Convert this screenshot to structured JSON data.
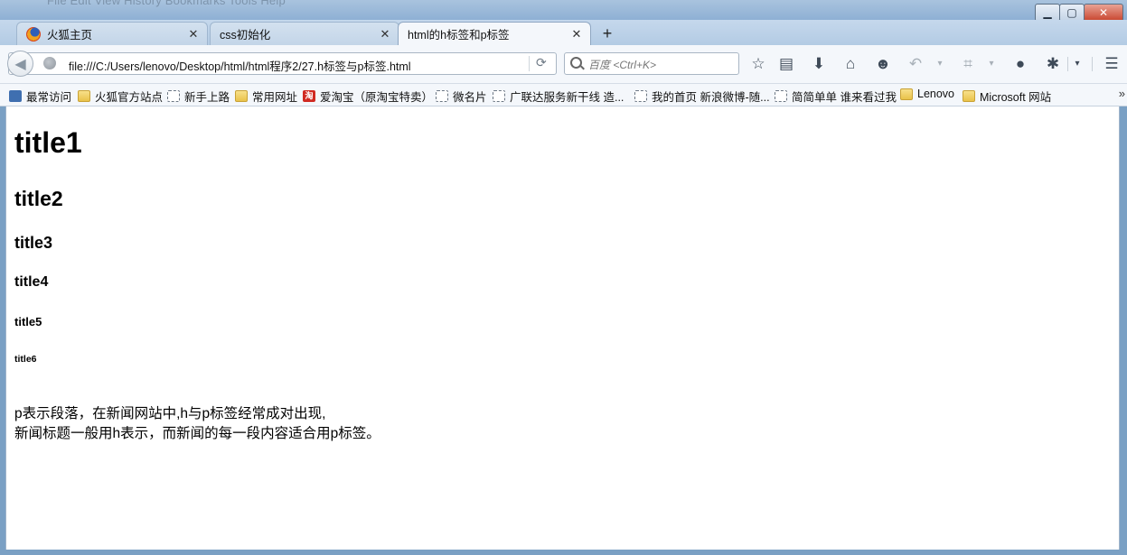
{
  "window": {
    "menubar_ghost": "File  Edit  View  History  Bookmarks  Tools  Help",
    "controls": {
      "minimize": "▁",
      "maximize": "▢",
      "close": "✕"
    }
  },
  "tabs": [
    {
      "label": "火狐主页",
      "close": "✕"
    },
    {
      "label": "css初始化",
      "close": "✕"
    },
    {
      "label": "html的h标签和p标签",
      "close": "✕"
    }
  ],
  "new_tab_label": "+",
  "navbar": {
    "back": "◀",
    "url": "file:///C:/Users/lenovo/Desktop/html/html程序2/27.h标签与p标签.html",
    "reload": "⟳",
    "search_placeholder": "百度 <Ctrl+K>",
    "tools": {
      "bookmark_star": "☆",
      "reading_list": "▤",
      "download": "⬇",
      "home": "⌂",
      "chat": "☻",
      "undo": "↶",
      "dropdown": "▾",
      "crop": "⌗",
      "comment": "●",
      "bug": "✱",
      "menu": "☰"
    }
  },
  "bookmarks": [
    {
      "label": "最常访问",
      "icon": "blue-icon"
    },
    {
      "label": "火狐官方站点",
      "icon": "folder-icon"
    },
    {
      "label": "新手上路",
      "icon": "page-icon"
    },
    {
      "label": "常用网址",
      "icon": "folder-icon"
    },
    {
      "label": "爱淘宝（原淘宝特卖）",
      "icon": "red-icon",
      "icon_text": "淘"
    },
    {
      "label": "微名片",
      "icon": "page-icon"
    },
    {
      "label": "广联达服务新干线 造...",
      "icon": "page-icon"
    },
    {
      "label": "我的首页 新浪微博-随...",
      "icon": "page-icon"
    },
    {
      "label": "简简单单 谁来看过我",
      "icon": "page-icon"
    },
    {
      "label": "Lenovo",
      "icon": "folder-icon"
    },
    {
      "label": "Microsoft 网站",
      "icon": "folder-icon"
    }
  ],
  "bookmarks_more": "»",
  "page": {
    "h1": "title1",
    "h2": "title2",
    "h3": "title3",
    "h4": "title4",
    "h5": "title5",
    "h6": "title6",
    "p_line1": "p表示段落，在新闻网站中,h与p标签经常成对出现,",
    "p_line2": "新闻标题一般用h表示，而新闻的每一段内容适合用p标签。"
  }
}
